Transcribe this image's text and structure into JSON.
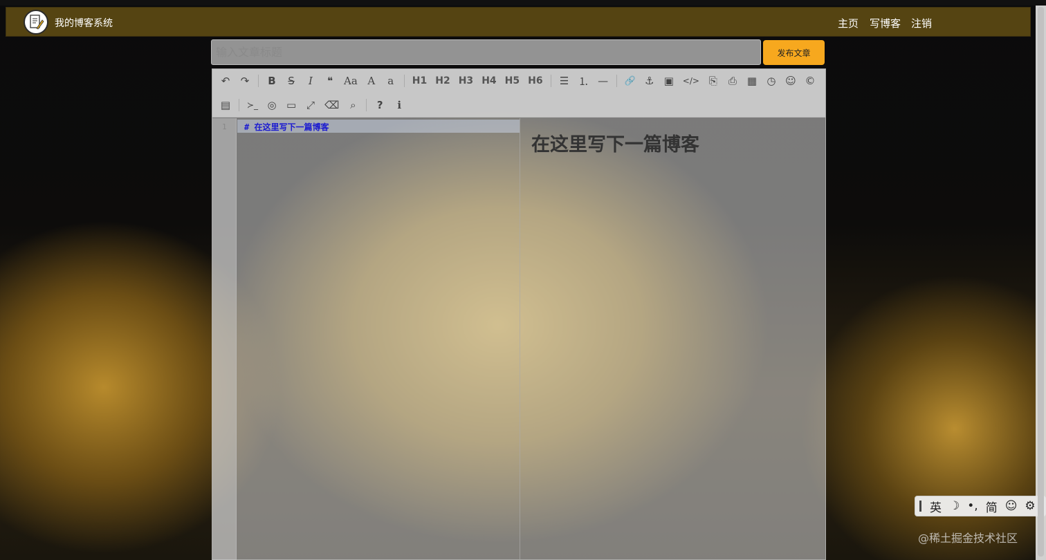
{
  "header": {
    "site_title": "我的博客系统",
    "nav": [
      {
        "label": "主页"
      },
      {
        "label": "写博客"
      },
      {
        "label": "注销"
      }
    ]
  },
  "editor": {
    "title_placeholder": "输入文章标题",
    "publish_label": "发布文章",
    "toolbar_row1": [
      "undo-icon",
      "redo-icon",
      "bold-icon",
      "strikethrough-icon",
      "italic-icon",
      "quote-icon",
      "uppercase-icon",
      "ucwords-icon",
      "lowercase-icon"
    ],
    "headings": [
      "H1",
      "H2",
      "H3",
      "H4",
      "H5",
      "H6"
    ],
    "glyphs": {
      "undo": "↶",
      "redo": "↷",
      "bold": "B",
      "strike": "S",
      "italic": "I",
      "quote": "❝",
      "upper": "Aa",
      "ucwords": "A",
      "lower": "a",
      "ul": "☰",
      "ol": "⒈",
      "hr": "—",
      "link": "🔗",
      "anchor": "⚓",
      "image": "▣",
      "code": "</>",
      "codeblock": "⎘",
      "pre": "⎙",
      "table": "▦",
      "datetime": "◷",
      "emoji": "☺",
      "copyright": "©",
      "html": "▤",
      "goto": "≻_",
      "watch": "◎",
      "preview": "▭",
      "fullscreen": "⤢",
      "clear": "⌫",
      "search": "⌕",
      "help": "?",
      "info": "ℹ"
    },
    "line_number": "1",
    "code_text": "# 在这里写下一篇博客",
    "preview_heading": "在这里写下一篇博客"
  },
  "ime": {
    "items": [
      "英",
      "☽",
      "•,",
      "简",
      "☺",
      "⚙"
    ]
  },
  "watermark": "@稀土掘金技术社区"
}
